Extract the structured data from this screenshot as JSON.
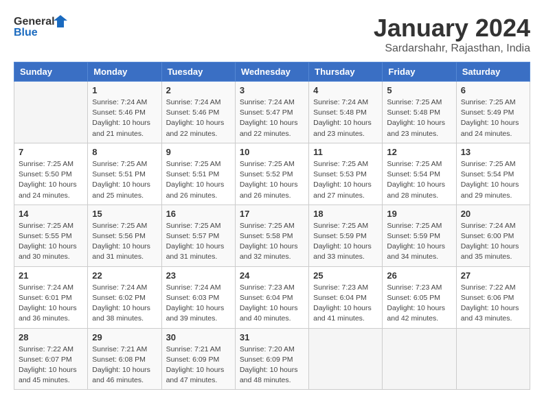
{
  "header": {
    "logo_general": "General",
    "logo_blue": "Blue",
    "title": "January 2024",
    "subtitle": "Sardarshahr, Rajasthan, India"
  },
  "weekdays": [
    "Sunday",
    "Monday",
    "Tuesday",
    "Wednesday",
    "Thursday",
    "Friday",
    "Saturday"
  ],
  "weeks": [
    [
      {
        "day": "",
        "sunrise": "",
        "sunset": "",
        "daylight": ""
      },
      {
        "day": "1",
        "sunrise": "Sunrise: 7:24 AM",
        "sunset": "Sunset: 5:46 PM",
        "daylight": "Daylight: 10 hours and 21 minutes."
      },
      {
        "day": "2",
        "sunrise": "Sunrise: 7:24 AM",
        "sunset": "Sunset: 5:46 PM",
        "daylight": "Daylight: 10 hours and 22 minutes."
      },
      {
        "day": "3",
        "sunrise": "Sunrise: 7:24 AM",
        "sunset": "Sunset: 5:47 PM",
        "daylight": "Daylight: 10 hours and 22 minutes."
      },
      {
        "day": "4",
        "sunrise": "Sunrise: 7:24 AM",
        "sunset": "Sunset: 5:48 PM",
        "daylight": "Daylight: 10 hours and 23 minutes."
      },
      {
        "day": "5",
        "sunrise": "Sunrise: 7:25 AM",
        "sunset": "Sunset: 5:48 PM",
        "daylight": "Daylight: 10 hours and 23 minutes."
      },
      {
        "day": "6",
        "sunrise": "Sunrise: 7:25 AM",
        "sunset": "Sunset: 5:49 PM",
        "daylight": "Daylight: 10 hours and 24 minutes."
      }
    ],
    [
      {
        "day": "7",
        "sunrise": "Sunrise: 7:25 AM",
        "sunset": "Sunset: 5:50 PM",
        "daylight": "Daylight: 10 hours and 24 minutes."
      },
      {
        "day": "8",
        "sunrise": "Sunrise: 7:25 AM",
        "sunset": "Sunset: 5:51 PM",
        "daylight": "Daylight: 10 hours and 25 minutes."
      },
      {
        "day": "9",
        "sunrise": "Sunrise: 7:25 AM",
        "sunset": "Sunset: 5:51 PM",
        "daylight": "Daylight: 10 hours and 26 minutes."
      },
      {
        "day": "10",
        "sunrise": "Sunrise: 7:25 AM",
        "sunset": "Sunset: 5:52 PM",
        "daylight": "Daylight: 10 hours and 26 minutes."
      },
      {
        "day": "11",
        "sunrise": "Sunrise: 7:25 AM",
        "sunset": "Sunset: 5:53 PM",
        "daylight": "Daylight: 10 hours and 27 minutes."
      },
      {
        "day": "12",
        "sunrise": "Sunrise: 7:25 AM",
        "sunset": "Sunset: 5:54 PM",
        "daylight": "Daylight: 10 hours and 28 minutes."
      },
      {
        "day": "13",
        "sunrise": "Sunrise: 7:25 AM",
        "sunset": "Sunset: 5:54 PM",
        "daylight": "Daylight: 10 hours and 29 minutes."
      }
    ],
    [
      {
        "day": "14",
        "sunrise": "Sunrise: 7:25 AM",
        "sunset": "Sunset: 5:55 PM",
        "daylight": "Daylight: 10 hours and 30 minutes."
      },
      {
        "day": "15",
        "sunrise": "Sunrise: 7:25 AM",
        "sunset": "Sunset: 5:56 PM",
        "daylight": "Daylight: 10 hours and 31 minutes."
      },
      {
        "day": "16",
        "sunrise": "Sunrise: 7:25 AM",
        "sunset": "Sunset: 5:57 PM",
        "daylight": "Daylight: 10 hours and 31 minutes."
      },
      {
        "day": "17",
        "sunrise": "Sunrise: 7:25 AM",
        "sunset": "Sunset: 5:58 PM",
        "daylight": "Daylight: 10 hours and 32 minutes."
      },
      {
        "day": "18",
        "sunrise": "Sunrise: 7:25 AM",
        "sunset": "Sunset: 5:59 PM",
        "daylight": "Daylight: 10 hours and 33 minutes."
      },
      {
        "day": "19",
        "sunrise": "Sunrise: 7:25 AM",
        "sunset": "Sunset: 5:59 PM",
        "daylight": "Daylight: 10 hours and 34 minutes."
      },
      {
        "day": "20",
        "sunrise": "Sunrise: 7:24 AM",
        "sunset": "Sunset: 6:00 PM",
        "daylight": "Daylight: 10 hours and 35 minutes."
      }
    ],
    [
      {
        "day": "21",
        "sunrise": "Sunrise: 7:24 AM",
        "sunset": "Sunset: 6:01 PM",
        "daylight": "Daylight: 10 hours and 36 minutes."
      },
      {
        "day": "22",
        "sunrise": "Sunrise: 7:24 AM",
        "sunset": "Sunset: 6:02 PM",
        "daylight": "Daylight: 10 hours and 38 minutes."
      },
      {
        "day": "23",
        "sunrise": "Sunrise: 7:24 AM",
        "sunset": "Sunset: 6:03 PM",
        "daylight": "Daylight: 10 hours and 39 minutes."
      },
      {
        "day": "24",
        "sunrise": "Sunrise: 7:23 AM",
        "sunset": "Sunset: 6:04 PM",
        "daylight": "Daylight: 10 hours and 40 minutes."
      },
      {
        "day": "25",
        "sunrise": "Sunrise: 7:23 AM",
        "sunset": "Sunset: 6:04 PM",
        "daylight": "Daylight: 10 hours and 41 minutes."
      },
      {
        "day": "26",
        "sunrise": "Sunrise: 7:23 AM",
        "sunset": "Sunset: 6:05 PM",
        "daylight": "Daylight: 10 hours and 42 minutes."
      },
      {
        "day": "27",
        "sunrise": "Sunrise: 7:22 AM",
        "sunset": "Sunset: 6:06 PM",
        "daylight": "Daylight: 10 hours and 43 minutes."
      }
    ],
    [
      {
        "day": "28",
        "sunrise": "Sunrise: 7:22 AM",
        "sunset": "Sunset: 6:07 PM",
        "daylight": "Daylight: 10 hours and 45 minutes."
      },
      {
        "day": "29",
        "sunrise": "Sunrise: 7:21 AM",
        "sunset": "Sunset: 6:08 PM",
        "daylight": "Daylight: 10 hours and 46 minutes."
      },
      {
        "day": "30",
        "sunrise": "Sunrise: 7:21 AM",
        "sunset": "Sunset: 6:09 PM",
        "daylight": "Daylight: 10 hours and 47 minutes."
      },
      {
        "day": "31",
        "sunrise": "Sunrise: 7:20 AM",
        "sunset": "Sunset: 6:09 PM",
        "daylight": "Daylight: 10 hours and 48 minutes."
      },
      {
        "day": "",
        "sunrise": "",
        "sunset": "",
        "daylight": ""
      },
      {
        "day": "",
        "sunrise": "",
        "sunset": "",
        "daylight": ""
      },
      {
        "day": "",
        "sunrise": "",
        "sunset": "",
        "daylight": ""
      }
    ]
  ]
}
